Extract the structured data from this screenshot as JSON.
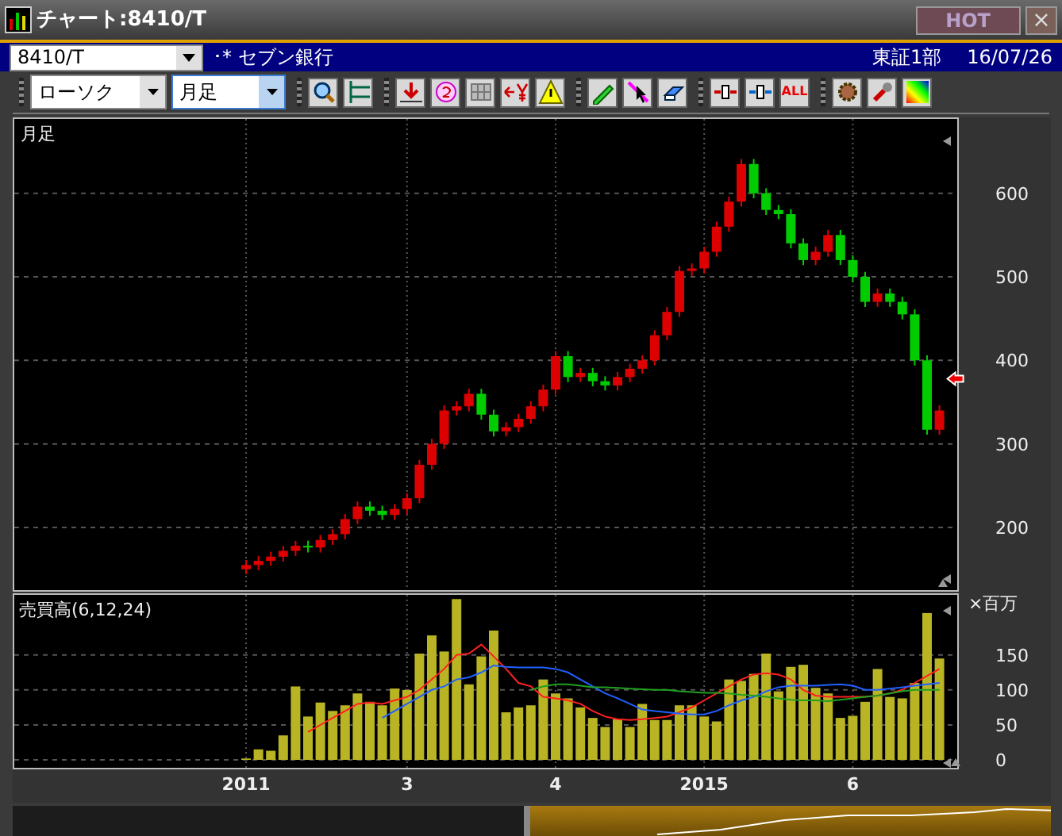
{
  "window": {
    "title": "チャート:8410/T",
    "hot_button": "HOT",
    "close_button": "×"
  },
  "symbol_bar": {
    "code": "8410/T",
    "name": "･* セブン銀行",
    "market": "東証1部",
    "date": "16/07/26"
  },
  "toolbar": {
    "chart_type": "ローソク",
    "period": "月足",
    "period_selected": true,
    "all_label": "ALL"
  },
  "price_panel": {
    "label": "月足",
    "chart_data": {
      "type": "candlestick",
      "categories": [
        null,
        null,
        null,
        null,
        null,
        null,
        null,
        null,
        null,
        null,
        null,
        null,
        null,
        null,
        null,
        null,
        null,
        null,
        null,
        null,
        null,
        null,
        null,
        null,
        null,
        null,
        null,
        null,
        null,
        null,
        null,
        null,
        null,
        null,
        null,
        null,
        null,
        null,
        null,
        null,
        null,
        null,
        null,
        null,
        null,
        null,
        null,
        null,
        null,
        null,
        null,
        null,
        null,
        null,
        null,
        null,
        null
      ],
      "ohlc": [
        [
          150,
          161,
          144,
          155
        ],
        [
          155,
          166,
          149,
          160
        ],
        [
          160,
          171,
          154,
          165
        ],
        [
          165,
          178,
          159,
          172
        ],
        [
          172,
          184,
          166,
          178
        ],
        [
          178,
          184,
          170,
          176
        ],
        [
          176,
          191,
          170,
          185
        ],
        [
          185,
          198,
          179,
          192
        ],
        [
          192,
          216,
          186,
          210
        ],
        [
          210,
          231,
          204,
          225
        ],
        [
          225,
          231,
          214,
          220
        ],
        [
          220,
          226,
          209,
          215
        ],
        [
          215,
          228,
          209,
          222
        ],
        [
          222,
          241,
          216,
          235
        ],
        [
          235,
          281,
          229,
          275
        ],
        [
          275,
          306,
          269,
          300
        ],
        [
          300,
          346,
          294,
          340
        ],
        [
          340,
          351,
          334,
          345
        ],
        [
          345,
          366,
          339,
          360
        ],
        [
          360,
          366,
          329,
          335
        ],
        [
          335,
          341,
          309,
          315
        ],
        [
          315,
          326,
          309,
          320
        ],
        [
          320,
          336,
          314,
          330
        ],
        [
          330,
          351,
          324,
          345
        ],
        [
          345,
          371,
          339,
          365
        ],
        [
          365,
          411,
          359,
          405
        ],
        [
          405,
          411,
          374,
          380
        ],
        [
          380,
          391,
          374,
          385
        ],
        [
          385,
          391,
          369,
          375
        ],
        [
          375,
          381,
          364,
          370
        ],
        [
          370,
          386,
          364,
          380
        ],
        [
          380,
          396,
          374,
          390
        ],
        [
          390,
          406,
          384,
          400
        ],
        [
          400,
          436,
          394,
          430
        ],
        [
          430,
          464,
          424,
          458
        ],
        [
          458,
          513,
          452,
          507
        ],
        [
          507,
          516,
          501,
          510
        ],
        [
          510,
          536,
          504,
          530
        ],
        [
          530,
          566,
          524,
          560
        ],
        [
          560,
          596,
          554,
          590
        ],
        [
          590,
          641,
          584,
          635
        ],
        [
          635,
          641,
          594,
          600
        ],
        [
          600,
          606,
          574,
          580
        ],
        [
          580,
          586,
          569,
          575
        ],
        [
          575,
          581,
          534,
          540
        ],
        [
          540,
          546,
          514,
          520
        ],
        [
          520,
          536,
          514,
          530
        ],
        [
          530,
          556,
          524,
          550
        ],
        [
          550,
          556,
          514,
          520
        ],
        [
          520,
          526,
          494,
          500
        ],
        [
          500,
          506,
          464,
          470
        ],
        [
          470,
          486,
          464,
          480
        ],
        [
          480,
          486,
          464,
          470
        ],
        [
          470,
          476,
          449,
          455
        ],
        [
          455,
          461,
          394,
          400
        ],
        [
          400,
          406,
          311,
          317
        ],
        [
          317,
          346,
          311,
          340
        ]
      ],
      "ylim": [
        125,
        687
      ],
      "yticks": [
        600,
        500,
        400,
        300,
        200
      ],
      "grid": true
    }
  },
  "volume_panel": {
    "unit": "×百万",
    "chart_data": {
      "type": "bar",
      "title": "売買高(6,12,24)",
      "categories": [
        "2011",
        null,
        null,
        null,
        null,
        null,
        null,
        null,
        null,
        null,
        null,
        null,
        null,
        "3",
        null,
        null,
        null,
        null,
        null,
        null,
        null,
        null,
        null,
        null,
        null,
        "4",
        null,
        null,
        null,
        null,
        null,
        null,
        null,
        null,
        null,
        null,
        null,
        "2015",
        null,
        null,
        null,
        null,
        null,
        null,
        null,
        null,
        null,
        null,
        null,
        "6",
        null,
        null,
        null,
        null,
        null,
        null,
        null
      ],
      "series": [
        {
          "type": "bar",
          "color": "#b8b424",
          "values": [
            2,
            15,
            13,
            35,
            105,
            62,
            82,
            70,
            78,
            95,
            83,
            78,
            102,
            100,
            152,
            178,
            155,
            230,
            108,
            148,
            185,
            68,
            75,
            78,
            115,
            95,
            88,
            75,
            60,
            47,
            58,
            47,
            80,
            57,
            57,
            78,
            78,
            62,
            55,
            115,
            113,
            123,
            152,
            98,
            133,
            136,
            103,
            95,
            60,
            63,
            83,
            130,
            90,
            88,
            110,
            210,
            145
          ]
        },
        {
          "type": "line",
          "color": "#ff2020",
          "values": [
            null,
            null,
            null,
            null,
            null,
            40,
            50,
            60,
            70,
            80,
            82,
            80,
            85,
            90,
            100,
            115,
            130,
            150,
            152,
            165,
            148,
            130,
            110,
            105,
            90,
            88,
            85,
            80,
            70,
            62,
            58,
            57,
            58,
            60,
            62,
            68,
            75,
            85,
            95,
            105,
            115,
            122,
            124,
            122,
            115,
            100,
            92,
            90,
            90,
            90,
            90,
            92,
            95,
            100,
            110,
            120,
            130
          ]
        },
        {
          "type": "line",
          "color": "#2060ff",
          "values": [
            null,
            null,
            null,
            null,
            null,
            null,
            null,
            null,
            null,
            null,
            null,
            60,
            70,
            80,
            90,
            100,
            105,
            115,
            118,
            125,
            135,
            133,
            132,
            132,
            132,
            130,
            125,
            115,
            105,
            95,
            88,
            80,
            72,
            70,
            68,
            66,
            65,
            65,
            70,
            78,
            85,
            90,
            98,
            104,
            106,
            106,
            106,
            107,
            108,
            106,
            100,
            100,
            102,
            104,
            106,
            108,
            110
          ]
        },
        {
          "type": "line",
          "color": "#20a020",
          "values": [
            null,
            null,
            null,
            null,
            null,
            null,
            null,
            null,
            null,
            null,
            null,
            null,
            null,
            null,
            null,
            null,
            null,
            null,
            null,
            null,
            null,
            null,
            null,
            100,
            105,
            108,
            108,
            106,
            104,
            104,
            103,
            102,
            101,
            100,
            100,
            98,
            97,
            96,
            96,
            95,
            93,
            92,
            90,
            88,
            86,
            85,
            85,
            84,
            86,
            88,
            90,
            92,
            95,
            98,
            100,
            100,
            100
          ]
        }
      ],
      "ylim": [
        0,
        236
      ],
      "yticks": [
        0,
        50,
        100,
        150
      ],
      "grid": true
    }
  }
}
